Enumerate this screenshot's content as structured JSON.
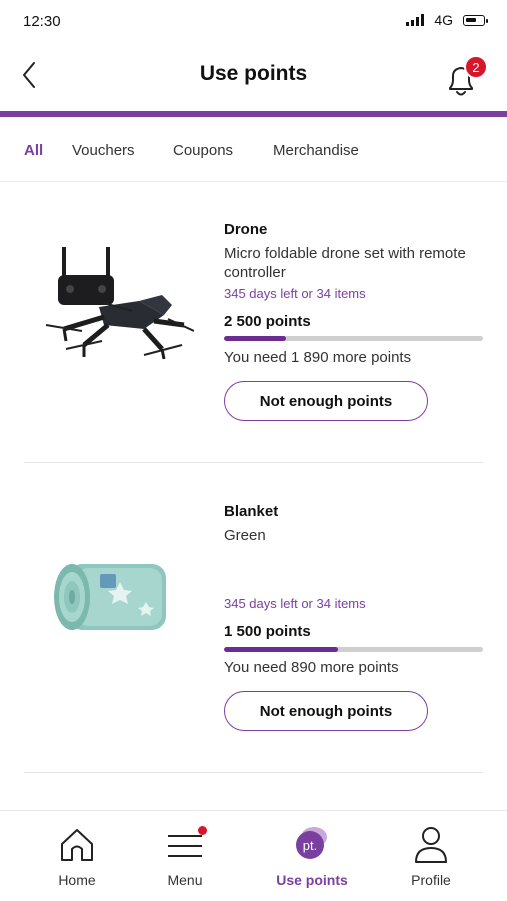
{
  "status_bar": {
    "time": "12:30",
    "network": "4G"
  },
  "header": {
    "title": "Use points",
    "notification_count": "2"
  },
  "tabs": [
    {
      "label": "All",
      "active": true
    },
    {
      "label": "Vouchers",
      "active": false
    },
    {
      "label": "Coupons",
      "active": false
    },
    {
      "label": "Merchandise",
      "active": false
    }
  ],
  "products": [
    {
      "name": "Drone",
      "description": "Micro foldable drone set with remote controller",
      "availability": "345 days left or 34 items",
      "points": "2 500 points",
      "progress": 0.24,
      "need": "You need 1 890 more points",
      "cta": "Not enough points"
    },
    {
      "name": "Blanket",
      "description": "Green",
      "availability": "345 days left or 34 items",
      "points": "1 500 points",
      "progress": 0.44,
      "need": "You need 890 more points",
      "cta": "Not enough points"
    }
  ],
  "bottom_nav": [
    {
      "label": "Home",
      "icon": "home-icon",
      "active": false
    },
    {
      "label": "Menu",
      "icon": "menu-icon",
      "active": false,
      "has_dot": true
    },
    {
      "label": "Use points",
      "icon": "points-icon",
      "icon_text": "pt.",
      "active": true
    },
    {
      "label": "Profile",
      "icon": "profile-icon",
      "active": false
    }
  ],
  "colors": {
    "accent": "#7b3fa0",
    "badge": "#d6162b",
    "progress_track": "#cfcfcf"
  }
}
